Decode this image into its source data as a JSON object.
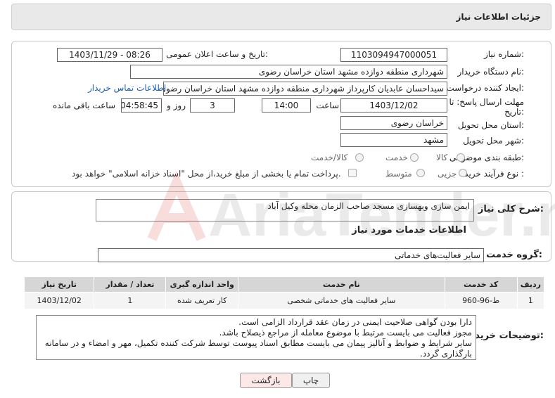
{
  "header": {
    "title": "جزئیات اطلاعات نیاز"
  },
  "form": {
    "need_number_label": "شماره نیاز:",
    "need_number": "1103094947000051",
    "announce_label": "تاریخ و ساعت اعلان عمومی:",
    "announce_value": "1403/11/29 - 08:26",
    "buyer_org_label": "نام دستگاه خریدار:",
    "buyer_org": "شهرداری منطقه دوازده مشهد استان خراسان رضوی",
    "requester_label": "ایجاد کننده درخواست:",
    "requester": "سیداحسان عابدیان کارپرداز شهرداری منطقه دوازده مشهد استان خراسان رضوی",
    "contact_link": "اطلاعات تماس خریدار",
    "deadline_label_1": "مهلت ارسال پاسخ: تا",
    "deadline_label_2": "تاریخ:",
    "deadline_date": "1403/12/02",
    "time_label": "ساعت",
    "deadline_time": "14:00",
    "days_value": "3",
    "days_label": "روز و",
    "remaining_time": "04:58:45",
    "remaining_label": "ساعت باقی مانده",
    "province_label": "استان محل تحویل:",
    "province": "خراسان رضوی",
    "city_label": "شهر محل تحویل:",
    "city": "مشهد",
    "category_label": "طبقه بندی موضوعی:",
    "category_options": [
      "کالا",
      "خدمت",
      "کالا/خدمت"
    ],
    "process_label": "نوع فرآیند خرید :",
    "process_options": [
      "جزیی",
      "متوسط"
    ],
    "payment_note": "پرداخت تمام یا بخشی از مبلغ خرید،از محل \"اسناد خزانه اسلامی\" خواهد بود."
  },
  "need": {
    "summary_label": "شرح کلی نیاز:",
    "summary": "ایمن سازی وبهسازی مسجد صاحب الزمان محله وکیل آباد",
    "services_title": "اطلاعات خدمات مورد نیاز",
    "group_label": "گروه خدمت:",
    "group_value": "سایر فعالیت‌های خدماتی"
  },
  "table": {
    "headers": [
      "ردیف",
      "کد خدمت",
      "نام خدمت",
      "واحد اندازه گیری",
      "تعداد / مقدار",
      "تاریخ نیاز"
    ],
    "rows": [
      [
        "1",
        "ط-96-960",
        "سایر فعالیت های خدماتی شخصی",
        "کار تعریف شده",
        "1",
        "1403/12/02"
      ]
    ]
  },
  "notes": {
    "label": "توضیحات خریدار:",
    "lines": [
      "دارا بودن گواهی صلاحیت ایمنی در زمان عقد قرارداد الزامی است.",
      "مجوز فعالیت می بایست مرتبط با موضوع معامله از مراجع ذیصلاح باشد.",
      "سایر شرایط و ضوابط و آنالیز پیمان می بایست مطابق اسناد پیوست توسط شرکت کننده تکمیل، مهر و امضاء و در سامانه بارگذاری گردد."
    ]
  },
  "buttons": {
    "print": "چاپ",
    "back": "بازگشت"
  },
  "watermark": {
    "text": "AriaTender.net"
  },
  "colors": {
    "link": "#1a5fb4",
    "back_button_bg": "#fde8e8",
    "header_bg": "#e9e9e9",
    "table_header_bg": "#d6d6d6"
  }
}
